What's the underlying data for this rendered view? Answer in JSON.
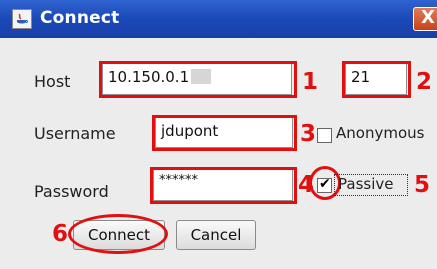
{
  "window": {
    "title": "Connect",
    "close_label": "X"
  },
  "form": {
    "host_label": "Host",
    "host_value": "10.150.0.1",
    "port_value": "21",
    "username_label": "Username",
    "username_value": "jdupont",
    "anonymous_label": "Anonymous",
    "anonymous_checked": false,
    "password_label": "Password",
    "password_value": "******",
    "passive_label": "Passive",
    "passive_checked": true
  },
  "buttons": {
    "connect_label": "Connect",
    "cancel_label": "Cancel"
  },
  "annotations": [
    "1",
    "2",
    "3",
    "4",
    "5",
    "6"
  ],
  "colors": {
    "titlebar": "#1b49b8",
    "annotation_red": "#e01010",
    "close_button": "#d0552b"
  },
  "icons": [
    "java-app-icon",
    "close-icon",
    "checkmark-icon"
  ]
}
